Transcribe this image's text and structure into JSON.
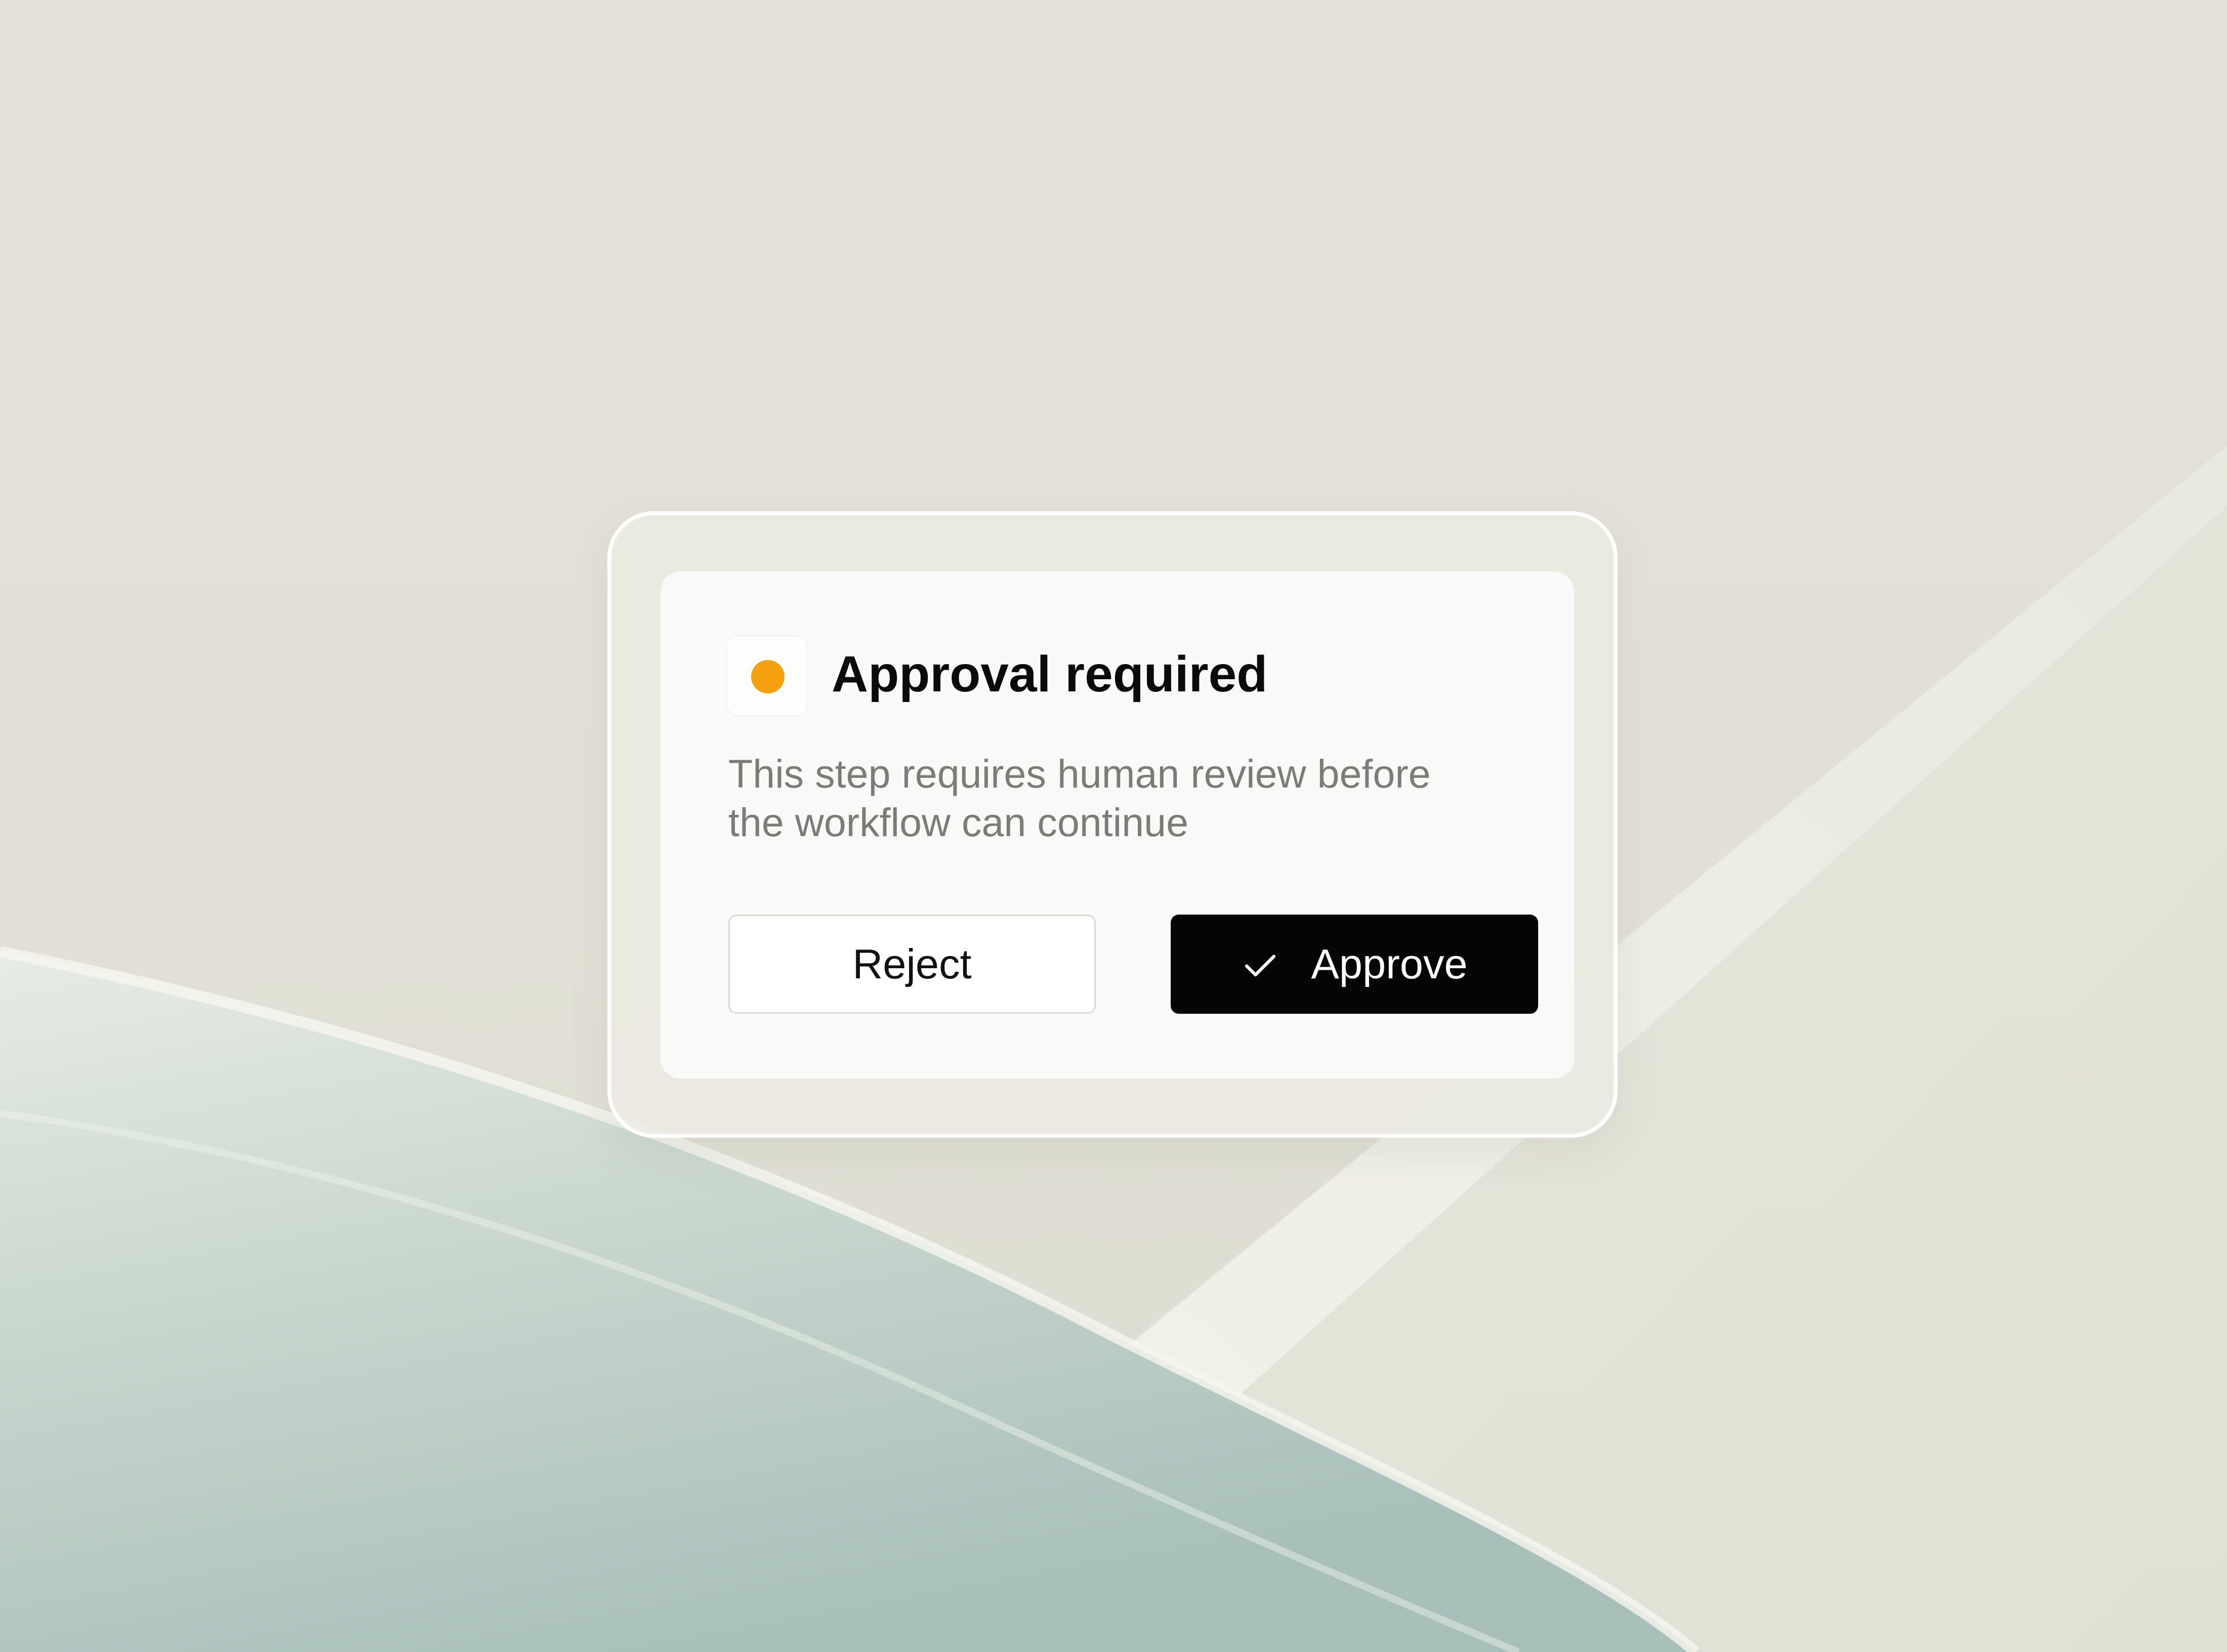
{
  "dialog": {
    "title": "Approval required",
    "description_lines": [
      "This step requires human review before",
      "the workflow can continue"
    ],
    "status_icon": "status-dot-icon",
    "reject_label": "Reject",
    "approve_label": "Approve",
    "approve_icon": "check-icon"
  },
  "colors": {
    "status_dot": "#F5A00E",
    "approve_button": "#050505",
    "title_text": "#0A0A0A",
    "description_text": "#7B7B77",
    "background": "#E2E0D7"
  }
}
